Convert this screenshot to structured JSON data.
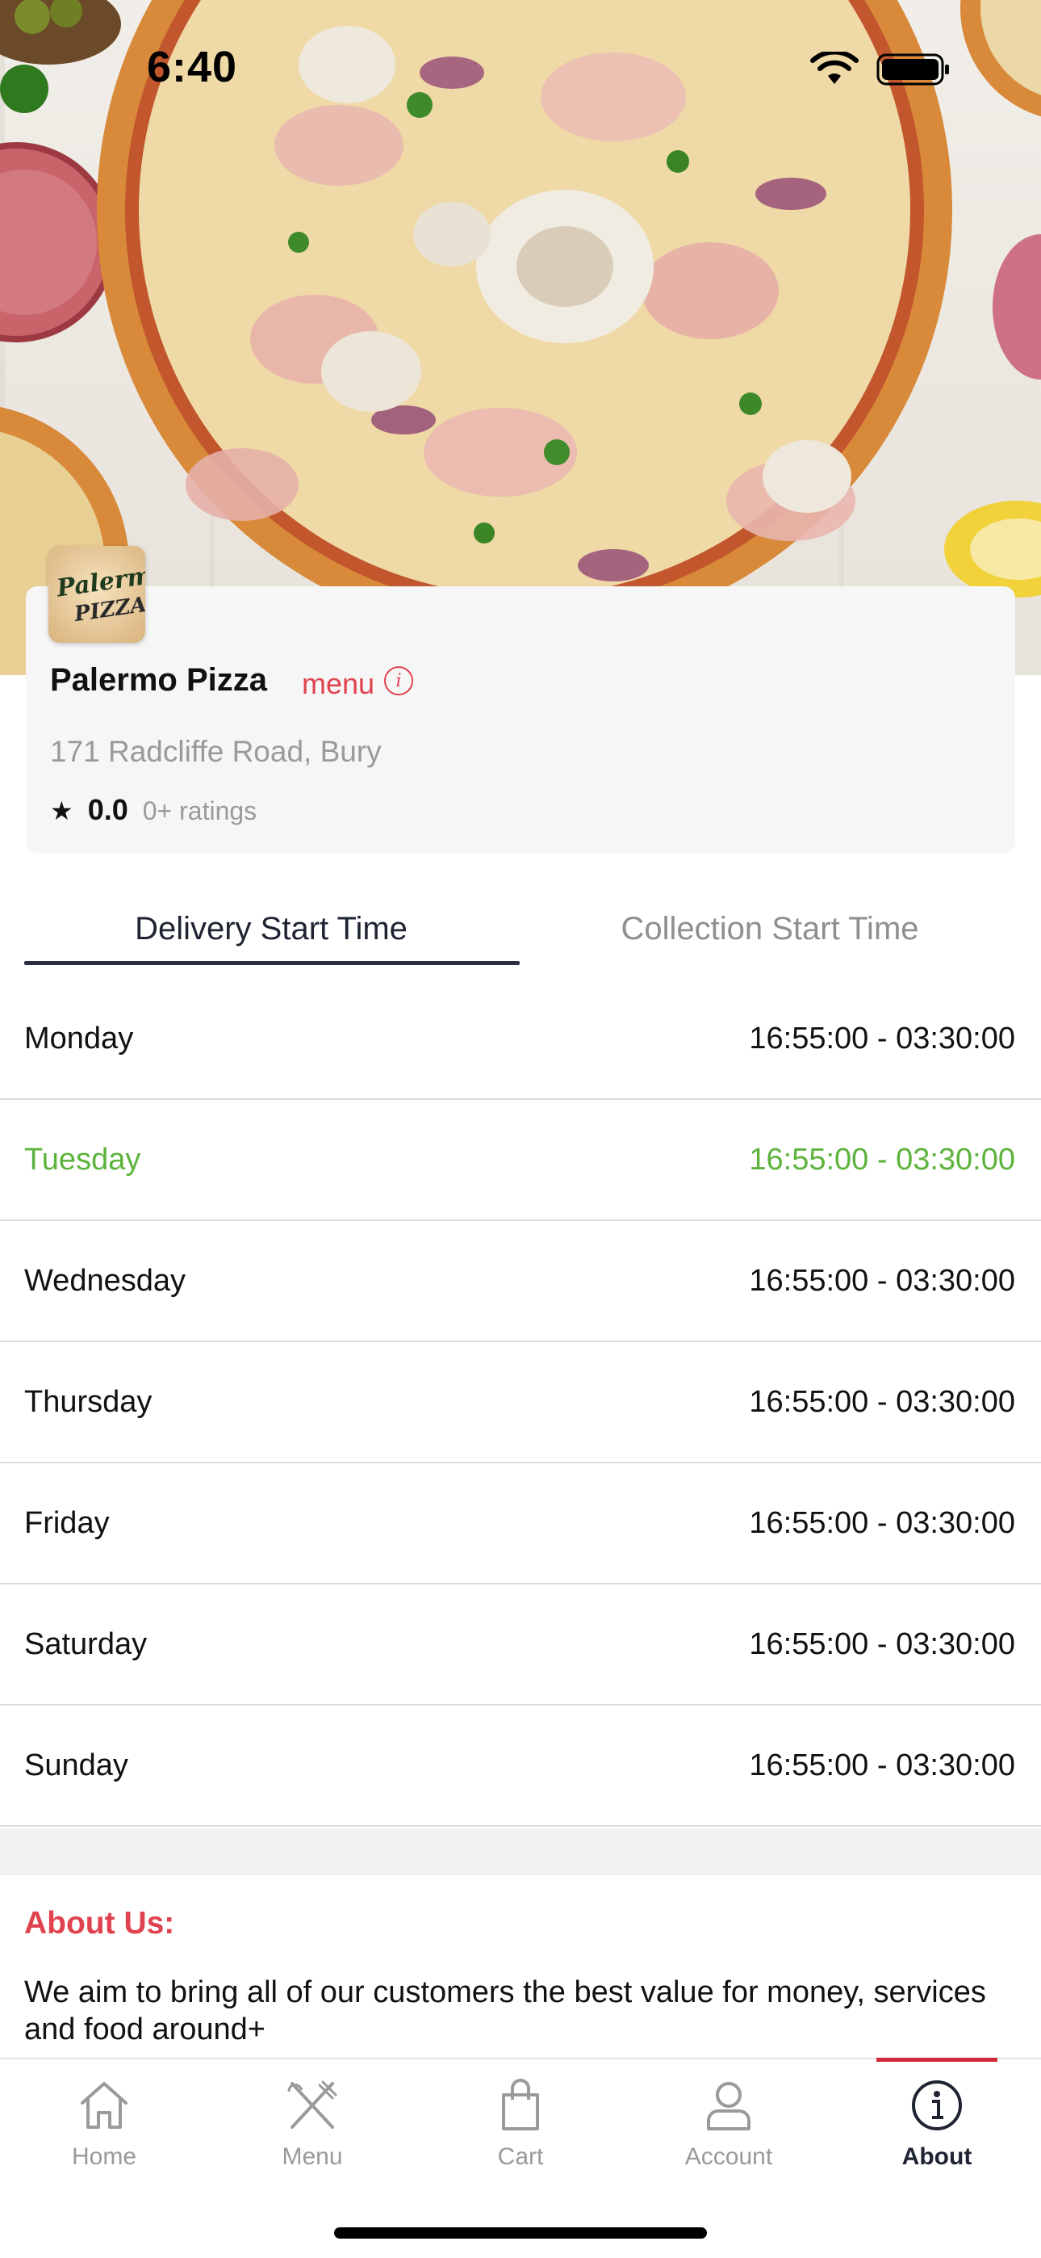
{
  "status_bar": {
    "time": "6:40"
  },
  "restaurant": {
    "logo_text_line1": "Palermo",
    "logo_text_line2": "PIZZA",
    "name": "Palermo Pizza",
    "menu_link": "menu",
    "address": "171 Radcliffe Road, Bury",
    "rating": "0.0",
    "rating_count": "0+ ratings"
  },
  "tabs": {
    "delivery": "Delivery Start Time",
    "collection": "Collection Start Time",
    "active": "delivery"
  },
  "hours": [
    {
      "day": "Monday",
      "time": "16:55:00 - 03:30:00"
    },
    {
      "day": "Tuesday",
      "time": "16:55:00 - 03:30:00",
      "highlight": true
    },
    {
      "day": "Wednesday",
      "time": "16:55:00 - 03:30:00"
    },
    {
      "day": "Thursday",
      "time": "16:55:00 - 03:30:00"
    },
    {
      "day": "Friday",
      "time": "16:55:00 - 03:30:00"
    },
    {
      "day": "Saturday",
      "time": "16:55:00 - 03:30:00"
    },
    {
      "day": "Sunday",
      "time": "16:55:00 - 03:30:00"
    }
  ],
  "about": {
    "title": "About Us:",
    "text": "We aim to bring all of our customers the best value for money, services and food around+"
  },
  "tabbar": {
    "items": [
      {
        "label": "Home",
        "icon": "home-icon"
      },
      {
        "label": "Menu",
        "icon": "fork-knife-icon"
      },
      {
        "label": "Cart",
        "icon": "shopping-bag-icon"
      },
      {
        "label": "Account",
        "icon": "user-icon"
      },
      {
        "label": "About",
        "icon": "info-icon",
        "active": true
      }
    ]
  },
  "colors": {
    "accent_red": "#e0424f",
    "today_green": "#5db33c",
    "tab_active": "#1f2433"
  }
}
